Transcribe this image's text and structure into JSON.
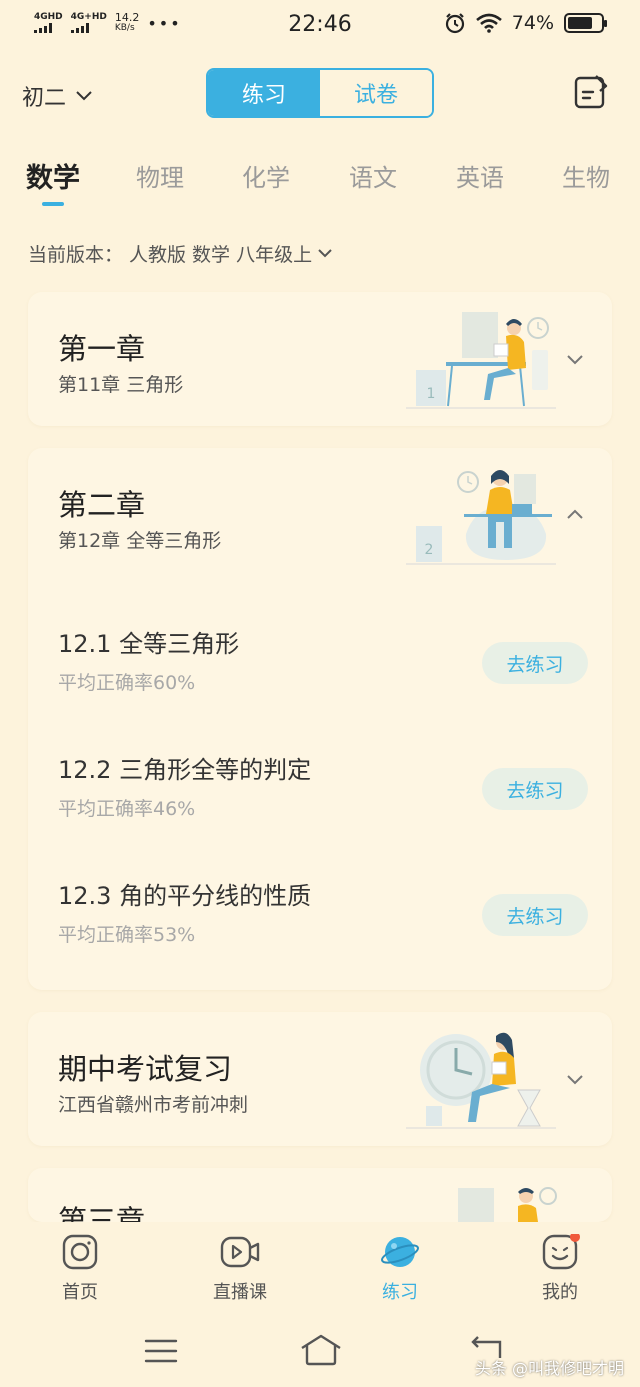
{
  "status_bar": {
    "signal1": "4GHD",
    "signal2": "4G+HD",
    "speed_value": "14.2",
    "speed_unit": "KB/s",
    "more": "•••",
    "time": "22:46",
    "battery": "74%",
    "battery_level": 0.74
  },
  "header": {
    "grade": "初二",
    "seg_practice": "练习",
    "seg_exam": "试卷",
    "note_icon": "note-edit-icon"
  },
  "tabs": [
    {
      "label": "数学",
      "active": true
    },
    {
      "label": "物理",
      "active": false
    },
    {
      "label": "化学",
      "active": false
    },
    {
      "label": "语文",
      "active": false
    },
    {
      "label": "英语",
      "active": false
    },
    {
      "label": "生物",
      "active": false
    }
  ],
  "version": {
    "label": "当前版本：",
    "value": "人教版 数学 八年级上"
  },
  "chapters": [
    {
      "title": "第一章",
      "subtitle": "第11章 三角形",
      "expanded": false
    },
    {
      "title": "第二章",
      "subtitle": "第12章 全等三角形",
      "expanded": true,
      "lessons": [
        {
          "title": "12.1 全等三角形",
          "rate": "平均正确率60%",
          "button": "去练习"
        },
        {
          "title": "12.2 三角形全等的判定",
          "rate": "平均正确率46%",
          "button": "去练习"
        },
        {
          "title": "12.3 角的平分线的性质",
          "rate": "平均正确率53%",
          "button": "去练习"
        }
      ]
    },
    {
      "title": "期中考试复习",
      "subtitle": "江西省赣州市考前冲刺",
      "expanded": false
    },
    {
      "title": "第三章",
      "subtitle": "",
      "expanded": false
    }
  ],
  "illustration_numbers": [
    "1",
    "2"
  ],
  "bottom_nav": [
    {
      "label": "首页",
      "icon": "camera-icon"
    },
    {
      "label": "直播课",
      "icon": "video-play-icon"
    },
    {
      "label": "练习",
      "icon": "planet-icon",
      "active": true
    },
    {
      "label": "我的",
      "icon": "smiley-icon",
      "badge": true
    }
  ],
  "colors": {
    "accent": "#3bb0e0",
    "background": "#fdf3dc",
    "card": "#fef6e3",
    "badge": "#f05a3c"
  },
  "watermark": "头条 @叫我修吧才明"
}
